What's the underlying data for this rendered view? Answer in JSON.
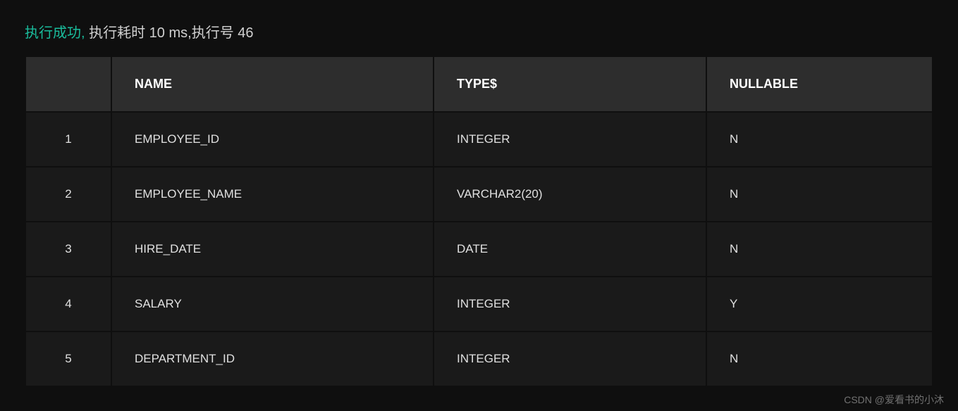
{
  "status": {
    "success_label": "执行成功,",
    "detail": " 执行耗时 10 ms,执行号 46"
  },
  "table": {
    "headers": {
      "rownum": "",
      "name": "NAME",
      "type": "TYPE$",
      "nullable": "NULLABLE"
    },
    "rows": [
      {
        "rownum": "1",
        "name": "EMPLOYEE_ID",
        "type": "INTEGER",
        "nullable": "N"
      },
      {
        "rownum": "2",
        "name": "EMPLOYEE_NAME",
        "type": "VARCHAR2(20)",
        "nullable": "N"
      },
      {
        "rownum": "3",
        "name": "HIRE_DATE",
        "type": "DATE",
        "nullable": "N"
      },
      {
        "rownum": "4",
        "name": "SALARY",
        "type": "INTEGER",
        "nullable": "Y"
      },
      {
        "rownum": "5",
        "name": "DEPARTMENT_ID",
        "type": "INTEGER",
        "nullable": "N"
      }
    ]
  },
  "watermark": "CSDN @爱看书的小沐"
}
